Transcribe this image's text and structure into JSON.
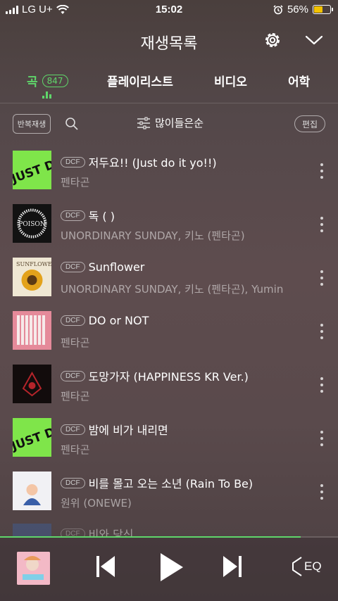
{
  "status_bar": {
    "carrier": "LG U+",
    "time": "15:02",
    "battery_percent": "56%",
    "battery_level": 0.56
  },
  "header": {
    "title": "재생목록"
  },
  "tabs": [
    {
      "label": "곡",
      "count": "847",
      "active": true
    },
    {
      "label": "플레이리스트"
    },
    {
      "label": "비디오"
    },
    {
      "label": "어학"
    }
  ],
  "toolbar": {
    "repeat_label": "반복재생",
    "sort_label": "많이들은순",
    "edit_label": "편집"
  },
  "badge": "DCF",
  "tracks": [
    {
      "title": "저두요!! (Just do it yo!!)",
      "artist": "펜타곤",
      "art_text": "JUST DO IT"
    },
    {
      "title": "독 ( )",
      "artist": "UNORDINARY SUNDAY, 키노 (펜타곤)",
      "art_text": "POISON"
    },
    {
      "title": "Sunflower",
      "artist": "UNORDINARY SUNDAY, 키노 (펜타곤), Yumin",
      "art_text": "SUNFLOWER"
    },
    {
      "title": "DO or NOT",
      "artist": "펜타곤"
    },
    {
      "title": "도망가자 (HAPPINESS KR Ver.)",
      "artist": "펜타곤"
    },
    {
      "title": "밤에 비가 내리면",
      "artist": "펜타곤",
      "art_text": "JUST DO IT"
    },
    {
      "title": "비를 몰고 오는 소년 (Rain To Be)",
      "artist": "원위 (ONEWE)"
    },
    {
      "title": "비와 당신"
    }
  ],
  "player": {
    "progress": 0.89,
    "eq_label": "EQ"
  },
  "colors": {
    "accent": "#5fd66a"
  }
}
